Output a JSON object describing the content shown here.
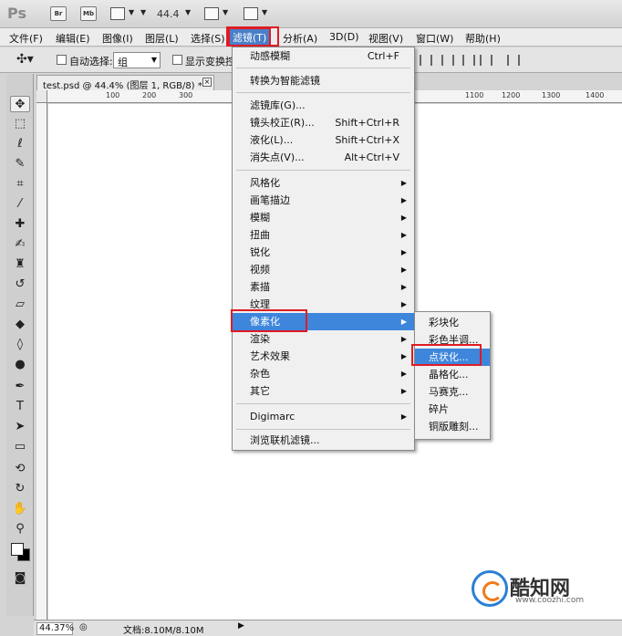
{
  "app": {
    "logo": "Ps",
    "bridge_label": "Br",
    "minibridge_label": "Mb",
    "zoom_value": "44.4"
  },
  "menubar": {
    "items": [
      "文件(F)",
      "编辑(E)",
      "图像(I)",
      "图层(L)",
      "选择(S)",
      "滤镜(T)",
      "分析(A)",
      "3D(D)",
      "视图(V)",
      "窗口(W)",
      "帮助(H)"
    ],
    "active_index": 5
  },
  "options": {
    "auto_select_label": "自动选择:",
    "auto_select_value": "组",
    "show_transform_label": "显示变换控"
  },
  "document": {
    "tab_title": "test.psd @ 44.4% (图层 1, RGB/8) *",
    "ruler_ticks": [
      "100",
      "200",
      "300",
      "1100",
      "1200",
      "1300",
      "1400"
    ],
    "zoom": "44.37%",
    "doc_info": "文档:8.10M/8.10M"
  },
  "filter_menu": {
    "groups": [
      [
        {
          "label": "动感模糊",
          "shortcut": "Ctrl+F"
        }
      ],
      [
        {
          "label": "转换为智能滤镜",
          "shortcut": ""
        }
      ],
      [
        {
          "label": "滤镜库(G)...",
          "shortcut": ""
        },
        {
          "label": "镜头校正(R)...",
          "shortcut": "Shift+Ctrl+R"
        },
        {
          "label": "液化(L)...",
          "shortcut": "Shift+Ctrl+X"
        },
        {
          "label": "消失点(V)...",
          "shortcut": "Alt+Ctrl+V"
        }
      ],
      [
        {
          "label": "风格化",
          "submenu": true
        },
        {
          "label": "画笔描边",
          "submenu": true
        },
        {
          "label": "模糊",
          "submenu": true
        },
        {
          "label": "扭曲",
          "submenu": true
        },
        {
          "label": "锐化",
          "submenu": true
        },
        {
          "label": "视频",
          "submenu": true
        },
        {
          "label": "素描",
          "submenu": true
        },
        {
          "label": "纹理",
          "submenu": true
        },
        {
          "label": "像素化",
          "submenu": true,
          "highlighted": true
        },
        {
          "label": "渲染",
          "submenu": true
        },
        {
          "label": "艺术效果",
          "submenu": true
        },
        {
          "label": "杂色",
          "submenu": true
        },
        {
          "label": "其它",
          "submenu": true
        }
      ],
      [
        {
          "label": "Digimarc",
          "submenu": true
        }
      ],
      [
        {
          "label": "浏览联机滤镜...",
          "shortcut": ""
        }
      ]
    ]
  },
  "pixelate_submenu": {
    "items": [
      "彩块化",
      "彩色半调...",
      "点状化...",
      "晶格化...",
      "马赛克...",
      "碎片",
      "铜版雕刻..."
    ],
    "highlighted_index": 2
  },
  "watermark": {
    "name": "酷知网",
    "url": "www.coozhi.com"
  },
  "colors": {
    "highlight": "#3e86dc",
    "annotation_red": "#e01b24"
  }
}
